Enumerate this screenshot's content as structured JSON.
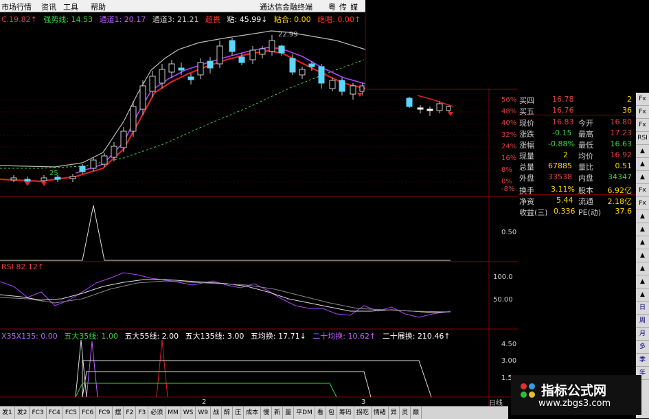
{
  "menu": {
    "items": [
      "市场行情",
      "资讯",
      "工具",
      "帮助"
    ],
    "window_title": "通达信金融终端",
    "window_menus": [
      "粤",
      "传",
      "媒"
    ]
  },
  "main_legend": {
    "items": [
      {
        "text": "C.19.82↑",
        "color": "#e04040"
      },
      {
        "text": "强势线: 14.53",
        "color": "#40d040"
      },
      {
        "text": "通道1: 20.17",
        "color": "#c060ff"
      },
      {
        "text": "通道3: 21.21",
        "color": "#cccccc"
      },
      {
        "text": "超畏",
        "color": "#ff3030"
      },
      {
        "text": "粘: 45.99↓",
        "color": "#ffffff"
      },
      {
        "text": "粘合: 0.00",
        "color": "#ffd700"
      },
      {
        "text": "绝唱: 0.00↑",
        "color": "#ff3030"
      }
    ]
  },
  "main_axis": [
    "56%",
    "48%",
    "40%",
    "32%",
    "24%",
    "16%",
    "8%",
    "0%",
    "-8%"
  ],
  "peak_label": "22.99",
  "low_label": "25",
  "sub1_axis": [
    "0.50"
  ],
  "sub2_legend": {
    "text": "RSI 82.12↑",
    "color": "#e04040"
  },
  "sub2_axis": [
    "100.0",
    "50.00"
  ],
  "sub3_legend": {
    "items": [
      {
        "text": "X35X135: 0.00",
        "color": "#c060ff"
      },
      {
        "text": "五大35线: 1.00",
        "color": "#40d040"
      },
      {
        "text": "五大55线: 2.00",
        "color": "#ffffff"
      },
      {
        "text": "五大135线: 3.00",
        "color": "#ffffff"
      },
      {
        "text": "五均换: 17.71↓",
        "color": "#ffffff"
      },
      {
        "text": "二十均换: 10.62↑",
        "color": "#c060ff"
      },
      {
        "text": "二十展换: 210.46↑",
        "color": "#ffffff"
      }
    ]
  },
  "sub3_axis": [
    "4.50",
    "3.00",
    "1.50"
  ],
  "x_labels": [
    "2",
    "3"
  ],
  "day_label": "日线",
  "quote": {
    "rows": [
      {
        "l1": "买四",
        "v1": "16.78",
        "l2": "",
        "v2": "2",
        "c1": "#e04040",
        "c2": "#ffd700"
      },
      {
        "l1": "买五",
        "v1": "16.76",
        "l2": "",
        "v2": "36",
        "c1": "#e04040",
        "c2": "#ffd700"
      },
      {
        "l1": "现价",
        "v1": "16.83",
        "l2": "今开",
        "v2": "16.80",
        "c1": "#e04040",
        "c2": "#e04040"
      },
      {
        "l1": "涨跌",
        "v1": "-0.15",
        "l2": "最高",
        "v2": "17.23",
        "c1": "#40d040",
        "c2": "#e04040"
      },
      {
        "l1": "涨幅",
        "v1": "-0.88%",
        "l2": "最低",
        "v2": "16.63",
        "c1": "#40d040",
        "c2": "#40d040"
      },
      {
        "l1": "现量",
        "v1": "2",
        "l2": "均价",
        "v2": "16.92",
        "c1": "#ffd700",
        "c2": "#e04040"
      },
      {
        "l1": "总量",
        "v1": "67885",
        "l2": "量比",
        "v2": "0.51",
        "c1": "#ffd700",
        "c2": "#ffd700"
      },
      {
        "l1": "外盘",
        "v1": "33538",
        "l2": "内盘",
        "v2": "34347",
        "c1": "#e04040",
        "c2": "#40d040"
      },
      {
        "l1": "换手",
        "v1": "3.11%",
        "l2": "股本",
        "v2": "6.92亿",
        "c1": "#ffd700",
        "c2": "#ffd700"
      },
      {
        "l1": "净资",
        "v1": "5.44",
        "l2": "流通",
        "v2": "2.18亿",
        "c1": "#ffd700",
        "c2": "#ffd700"
      },
      {
        "l1": "收益(三)",
        "v1": "0.336",
        "l2": "PE(动)",
        "v2": "37.6",
        "c1": "#ffd700",
        "c2": "#ffd700"
      }
    ]
  },
  "sidebar": [
    "Fx",
    "Fx",
    "Fx",
    "RSI",
    "▲",
    "▲",
    "▲",
    "Fx",
    "Fx",
    "▲",
    "▲",
    "▲",
    "▲",
    "▲",
    "▲",
    "▲",
    "日",
    "周",
    "月",
    "多",
    "季",
    "年"
  ],
  "tabs": [
    "发1",
    "发2",
    "FC3",
    "FC4",
    "FC5",
    "FC6",
    "FC9",
    "摆",
    "F2",
    "F3",
    "必须",
    "MM",
    "WS",
    "W9",
    "战",
    "醉",
    "庄",
    "成本",
    "慢",
    "新",
    "量",
    "平DM",
    "看",
    "包",
    "筹码",
    "拐吃",
    "情绪",
    "异",
    "灵",
    "巅"
  ],
  "watermark": {
    "title": "指标公式网",
    "url": "www.zbgs3.com"
  }
}
